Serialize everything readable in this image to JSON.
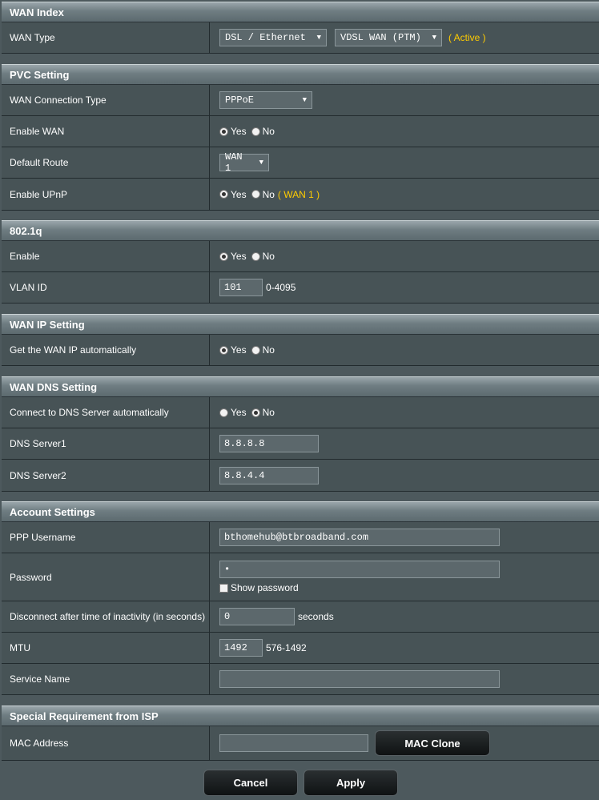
{
  "wan_index": {
    "title": "WAN Index",
    "wan_type_label": "WAN Type",
    "wan_type_value": "DSL / Ethernet",
    "wan_mode_value": "VDSL WAN (PTM)",
    "status": "( Active )"
  },
  "pvc": {
    "title": "PVC Setting",
    "conn_type_label": "WAN Connection Type",
    "conn_type_value": "PPPoE",
    "enable_wan_label": "Enable WAN",
    "default_route_label": "Default Route",
    "default_route_value": "WAN 1",
    "upnp_label": "Enable UPnP",
    "upnp_note": "( WAN 1 )"
  },
  "dot1q": {
    "title": "802.1q",
    "enable_label": "Enable",
    "vlan_label": "VLAN ID",
    "vlan_value": "101",
    "vlan_range": "0-4095"
  },
  "wan_ip": {
    "title": "WAN IP Setting",
    "auto_label": "Get the WAN IP automatically"
  },
  "wan_dns": {
    "title": "WAN DNS Setting",
    "auto_label": "Connect to DNS Server automatically",
    "dns1_label": "DNS Server1",
    "dns1_value": "8.8.8.8",
    "dns2_label": "DNS Server2",
    "dns2_value": "8.8.4.4"
  },
  "account": {
    "title": "Account Settings",
    "username_label": "PPP Username",
    "username_value": "bthomehub@btbroadband.com",
    "password_label": "Password",
    "password_value": "•",
    "show_password": "Show password",
    "idle_label": "Disconnect after time of inactivity (in seconds)",
    "idle_value": "0",
    "idle_unit": "seconds",
    "mtu_label": "MTU",
    "mtu_value": "1492",
    "mtu_range": "576-1492",
    "service_label": "Service Name",
    "service_value": ""
  },
  "isp": {
    "title": "Special Requirement from ISP",
    "mac_label": "MAC Address",
    "mac_value": "",
    "mac_clone": "MAC Clone"
  },
  "radio_yes": "Yes",
  "radio_no": "No",
  "buttons": {
    "cancel": "Cancel",
    "apply": "Apply"
  }
}
